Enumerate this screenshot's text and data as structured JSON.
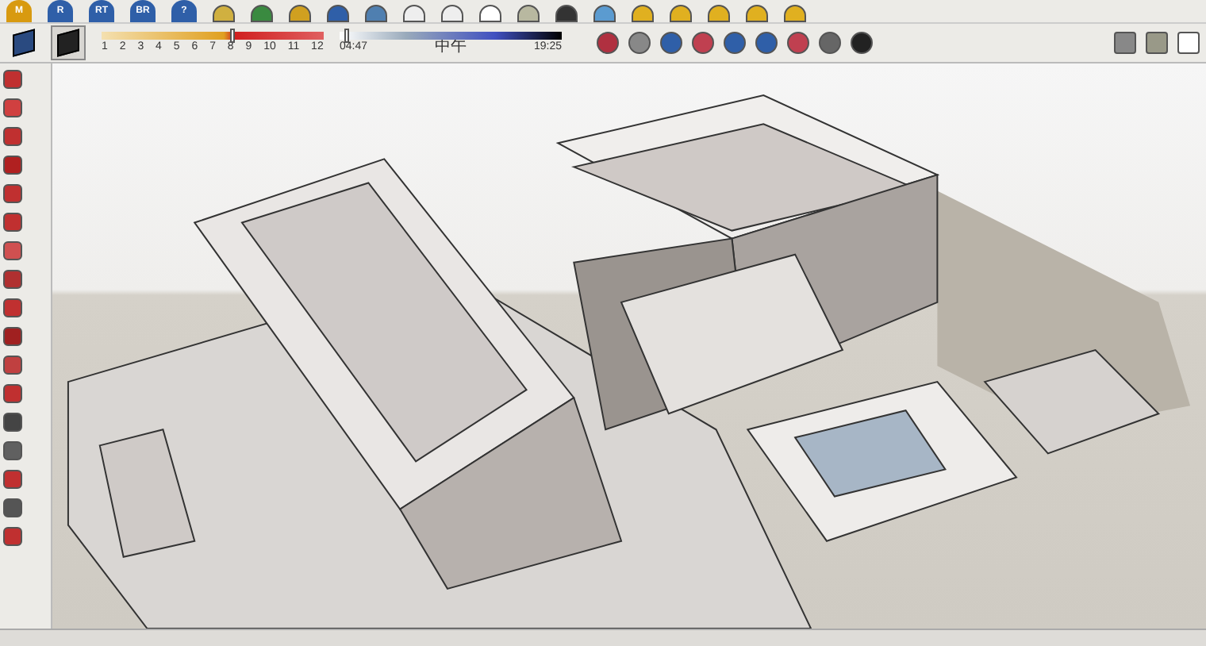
{
  "toolbar_top": {
    "letter_buttons": [
      {
        "label": "M",
        "color": "#d89a10"
      },
      {
        "label": "R",
        "color": "#2f5fa8"
      },
      {
        "label": "RT",
        "color": "#2f5fa8"
      },
      {
        "label": "BR",
        "color": "#2f5fa8"
      },
      {
        "label": "?",
        "color": "#2f5fa8"
      }
    ]
  },
  "style_buttons": [
    {
      "selected": false
    },
    {
      "selected": true
    }
  ],
  "shadow_bar": {
    "months": [
      "1",
      "2",
      "3",
      "4",
      "5",
      "6",
      "7",
      "8",
      "9",
      "10",
      "11",
      "12"
    ],
    "time_start": "04:47",
    "time_noon": "中午",
    "time_end": "19:25",
    "month_slider": {
      "level": 0.58
    },
    "time_slider": {
      "level": 0.02
    }
  }
}
